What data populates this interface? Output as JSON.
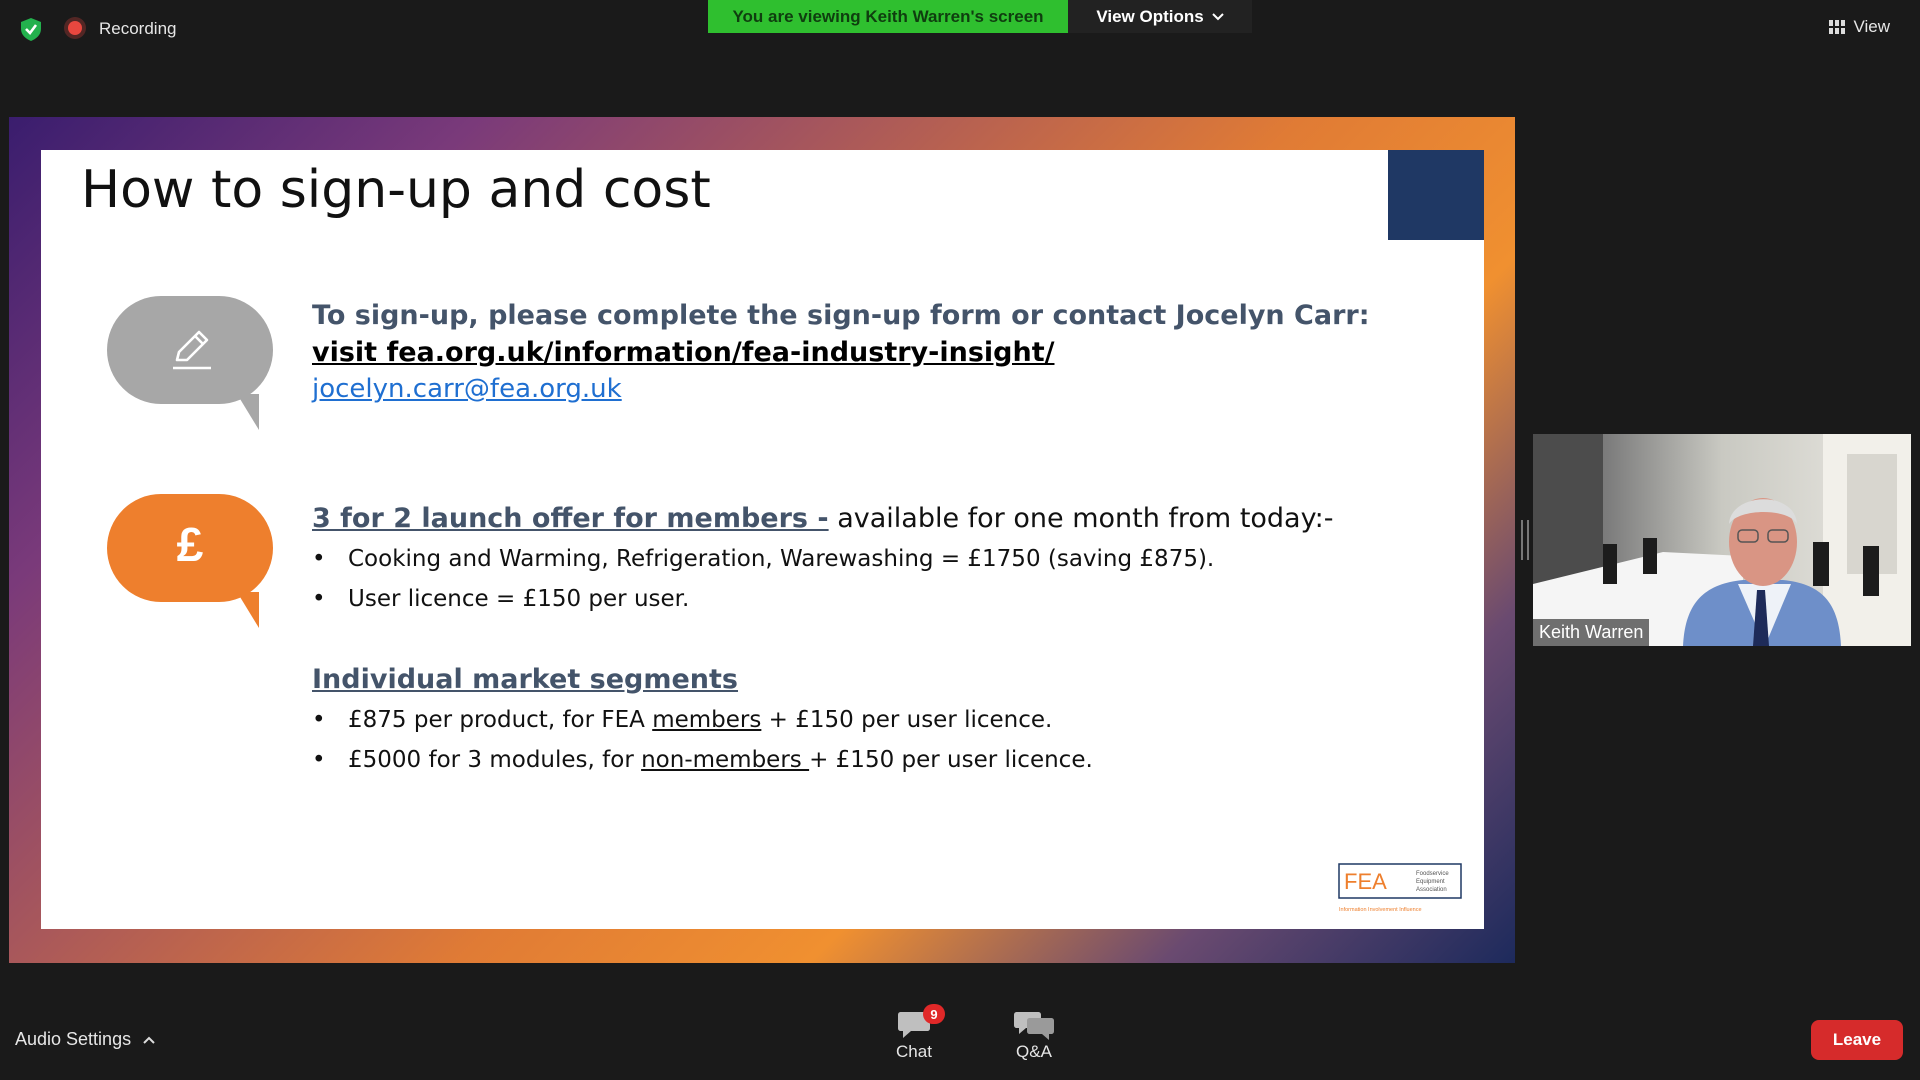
{
  "topbar": {
    "recording_label": "Recording",
    "viewing_banner": "You are viewing Keith Warren's screen",
    "view_options_label": "View Options",
    "view_label": "View"
  },
  "slide": {
    "title": "How to sign-up and cost",
    "signup": {
      "heading": "To sign-up, please complete the sign-up form or contact Jocelyn Carr:",
      "url_text": "visit fea.org.uk/information/fea-industry-insight/",
      "email_text": "jocelyn.carr@fea.org.uk"
    },
    "offer": {
      "heading": "3 for 2 launch offer for members -",
      "heading_rest": "available for one month from today:-",
      "bullets": [
        "Cooking and Warming, Refrigeration, Warewashing = £1750 (saving £875).",
        "User licence = £150 per user."
      ],
      "pound_symbol": "£"
    },
    "segments": {
      "heading": "Individual market segments",
      "b1_pre": "£875 per product, for FEA ",
      "b1_under": "members",
      "b1_post": " + £150 per user licence.",
      "b2_pre": "£5000 for 3 modules, for ",
      "b2_under": "non-members ",
      "b2_post": "+ £150 per user licence."
    },
    "logo": {
      "text": "FEA",
      "subtitle_1": "Foodservice",
      "subtitle_2": "Equipment",
      "subtitle_3": "Association",
      "tagline": "Information  Involvement  Influence"
    }
  },
  "video": {
    "participant_name": "Keith Warren"
  },
  "bottombar": {
    "audio_settings_label": "Audio Settings",
    "chat_label": "Chat",
    "chat_badge": "9",
    "qa_label": "Q&A",
    "leave_label": "Leave"
  },
  "colors": {
    "recording": "#e8473f",
    "banner": "#2fbf2f",
    "leave": "#d62b2b",
    "slide_heading": "#44546a",
    "link_blue": "#1f6fd1",
    "orange": "#ee7f2d",
    "navy": "#1f3864"
  }
}
